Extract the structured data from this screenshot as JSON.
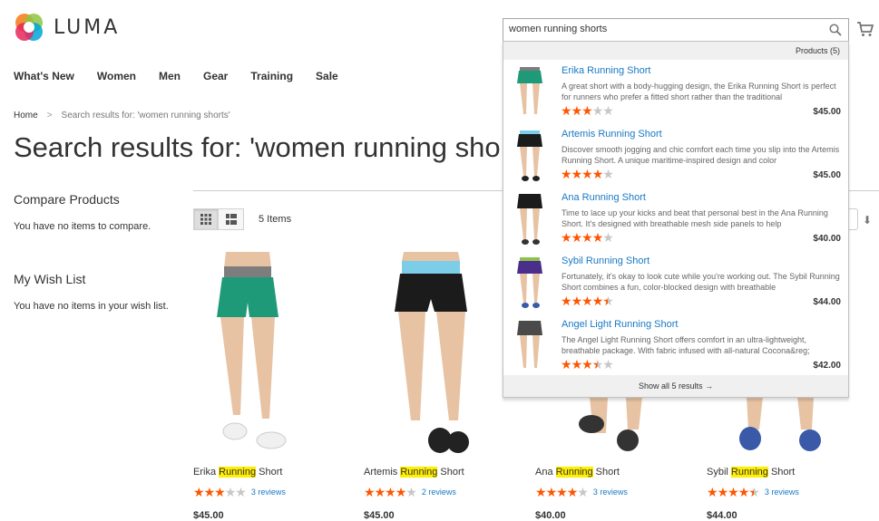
{
  "brand": {
    "name": "LUMA"
  },
  "nav": {
    "items": [
      "What's New",
      "Women",
      "Men",
      "Gear",
      "Training",
      "Sale"
    ]
  },
  "breadcrumb": {
    "home": "Home",
    "separator": ">",
    "current": "Search results for: 'women running shorts'"
  },
  "page": {
    "title": "Search results for: 'women running sho"
  },
  "sidebar": {
    "compare_title": "Compare Products",
    "compare_text": "You have no items to compare.",
    "wishlist_title": "My Wish List",
    "wishlist_text": "You have no items in your wish list."
  },
  "toolbar": {
    "item_count": "5 Items"
  },
  "search": {
    "value": "women running shorts",
    "results_header": "Products (5)",
    "show_all": "Show all 5 results →"
  },
  "suggestions": [
    {
      "name": "Erika Running Short",
      "desc": "A great short with a body-hugging design, the Erika Running Short is perfect for runners who prefer a fitted short rather than the traditional",
      "rating": 3,
      "price": "$45.00"
    },
    {
      "name": "Artemis Running Short",
      "desc": "Discover smooth jogging and chic comfort each time you slip into the Artemis Running Short. A unique maritime-inspired design and color",
      "rating": 4,
      "price": "$45.00"
    },
    {
      "name": "Ana Running Short",
      "desc": "Time to lace up your kicks and beat that personal best in the Ana Running Short. It's designed with breathable mesh side panels to help",
      "rating": 4,
      "price": "$40.00"
    },
    {
      "name": "Sybil Running Short",
      "desc": "Fortunately, it's okay to look cute while you're working out. The Sybil Running Short combines a fun, color-blocked design with breathable",
      "rating": 4.5,
      "price": "$44.00"
    },
    {
      "name": "Angel Light Running Short",
      "desc": "The Angel Light Running Short offers comfort in an ultra-lightweight, breathable package. With fabric infused with all-natural Cocona&reg;",
      "rating": 3.5,
      "price": "$42.00"
    }
  ],
  "products": [
    {
      "name_pre": "Erika ",
      "name_hl": "Running",
      "name_post": " Short",
      "rating": 3,
      "reviews": "3 reviews",
      "price": "$45.00",
      "short_color": "#1f9a78",
      "band_color": "#7d7d7d",
      "shoe_color": "#f0f0f0"
    },
    {
      "name_pre": "Artemis ",
      "name_hl": "Running",
      "name_post": " Short",
      "rating": 4,
      "reviews": "2 reviews",
      "price": "$45.00",
      "short_color": "#1b1b1b",
      "band_color": "#7ccde8",
      "shoe_color": "#222222"
    },
    {
      "name_pre": "Ana ",
      "name_hl": "Running",
      "name_post": " Short",
      "rating": 4,
      "reviews": "3 reviews",
      "price": "$40.00",
      "short_color": "#1b1b1b",
      "band_color": "#1b1b1b",
      "shoe_color": "#333333"
    },
    {
      "name_pre": "Sybil ",
      "name_hl": "Running",
      "name_post": " Short",
      "rating": 4.5,
      "reviews": "3 reviews",
      "price": "$44.00",
      "short_color": "#4b2e8c",
      "band_color": "#8bc34a",
      "shoe_color": "#3a5aa8"
    }
  ],
  "colors": {
    "accent_link": "#1979c3",
    "star": "#ff5501",
    "highlight": "#ffee00"
  }
}
